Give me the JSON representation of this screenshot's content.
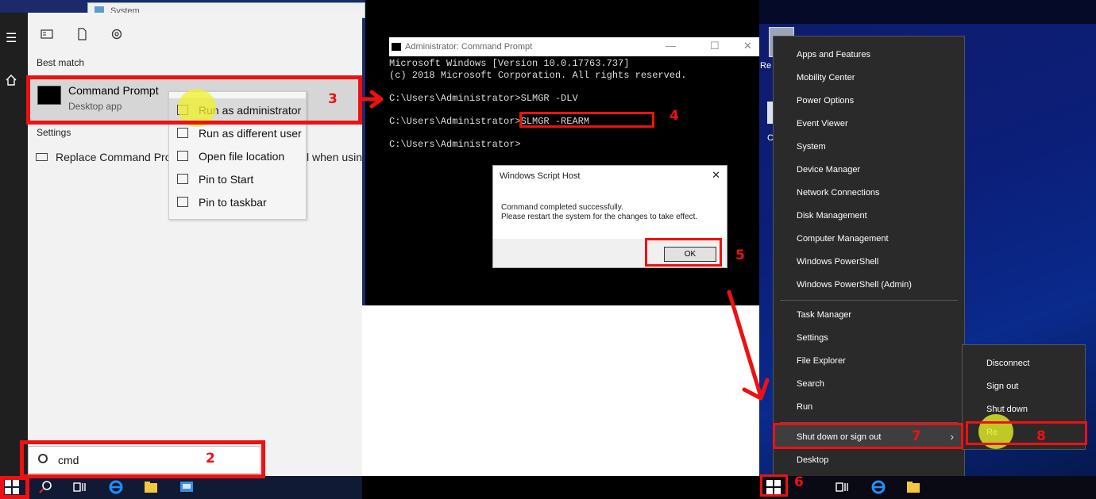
{
  "background_window": {
    "title": "System"
  },
  "start_menu": {
    "section_best_match": "Best match",
    "best_match": {
      "name": "Command Prompt",
      "subtitle": "Desktop app"
    },
    "section_settings": "Settings",
    "settings_item": "Replace Command Prom",
    "settings_item_tail": "l when usin",
    "context_menu": [
      {
        "label": "Run as administrator",
        "icon": "shield-run-icon"
      },
      {
        "label": "Run as different user",
        "icon": "user-icon"
      },
      {
        "label": "Open file location",
        "icon": "file-location-icon"
      },
      {
        "label": "Pin to Start",
        "icon": "pin-icon"
      },
      {
        "label": "Pin to taskbar",
        "icon": "pin-icon"
      }
    ],
    "search_value": "cmd"
  },
  "cmd_window": {
    "title": "Administrator: Command Prompt",
    "lines": [
      "Microsoft Windows [Version 10.0.17763.737]",
      "(c) 2018 Microsoft Corporation. All rights reserved.",
      "",
      "C:\\Users\\Administrator>SLMGR -DLV",
      "",
      "C:\\Users\\Administrator>SLMGR -REARM",
      "",
      "C:\\Users\\Administrator>"
    ]
  },
  "dialog": {
    "title": "Windows Script Host",
    "message_line1": "Command completed successfully.",
    "message_line2": "Please restart the system for the changes to take effect.",
    "ok_label": "OK"
  },
  "desktop": {
    "icon_label": "Re",
    "side_label": "C"
  },
  "winx_menu": {
    "group1": [
      "Apps and Features",
      "Mobility Center",
      "Power Options",
      "Event Viewer",
      "System",
      "Device Manager",
      "Network Connections",
      "Disk Management",
      "Computer Management",
      "Windows PowerShell",
      "Windows PowerShell (Admin)"
    ],
    "group2": [
      "Task Manager",
      "Settings",
      "File Explorer",
      "Search",
      "Run"
    ],
    "shutdown": "Shut down or sign out",
    "desktop": "Desktop"
  },
  "submenu": [
    "Disconnect",
    "Sign out",
    "Shut down",
    "Re"
  ],
  "annotations": {
    "n2": "2",
    "n3": "3",
    "n4": "4",
    "n5": "5",
    "n6": "6",
    "n7": "7",
    "n8": "8"
  },
  "colors": {
    "annotation": "#ee1111",
    "menu_bg": "#2a2a2a",
    "desktop_blue": "#0b1e78"
  }
}
